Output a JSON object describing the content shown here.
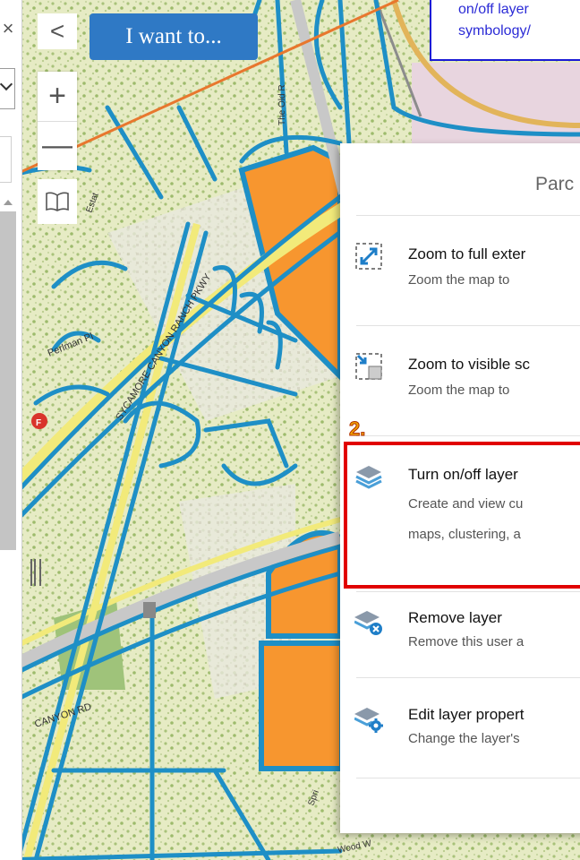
{
  "app": {
    "want_to_label": "I want to...",
    "back_glyph": "<",
    "zoom_in_glyph": "+",
    "zoom_out_glyph": "—",
    "close_glyph": "×",
    "icons": [
      "close-icon",
      "chevron-left-icon",
      "plus-icon",
      "minus-icon",
      "book-icon",
      "chevron-down-icon"
    ]
  },
  "callout": {
    "line1": "on/off layer",
    "line2": "symbology/"
  },
  "step": {
    "label": "2."
  },
  "menu": {
    "title": "Parc",
    "items": [
      {
        "title": "Zoom to full exter",
        "desc": "Zoom the map to",
        "icon": "zoom-full-extent-icon"
      },
      {
        "title": "Zoom to visible sc",
        "desc": "Zoom the map to",
        "icon": "zoom-visible-scale-icon"
      },
      {
        "title": "Turn on/off layer",
        "desc": "Create and view cu",
        "desc2": "maps, clustering, a",
        "icon": "layers-icon"
      },
      {
        "title": "Remove layer",
        "desc": "Remove this user a",
        "icon": "remove-layer-icon"
      },
      {
        "title": "Edit layer propert",
        "desc": "Change the layer's",
        "icon": "edit-layer-properties-icon"
      }
    ]
  },
  "map_labels": {
    "street1": "SYCAMORE CANYON RANCH PKWY",
    "street2": "Perlman Pl",
    "street3": "The Old R",
    "street4": "Estat",
    "street5": "CANYON RD",
    "street6": "Wood W",
    "street7": "Spri"
  },
  "colors": {
    "parcel_outline": "#1e8fc6",
    "parcel_fill_orange": "#f7962f",
    "road_yellow": "#f2ea7a",
    "button_blue": "#2f79c5",
    "highlight_red": "#e10000",
    "callout_blue": "#1a1ad6",
    "arrow_orange": "#e8772e"
  }
}
